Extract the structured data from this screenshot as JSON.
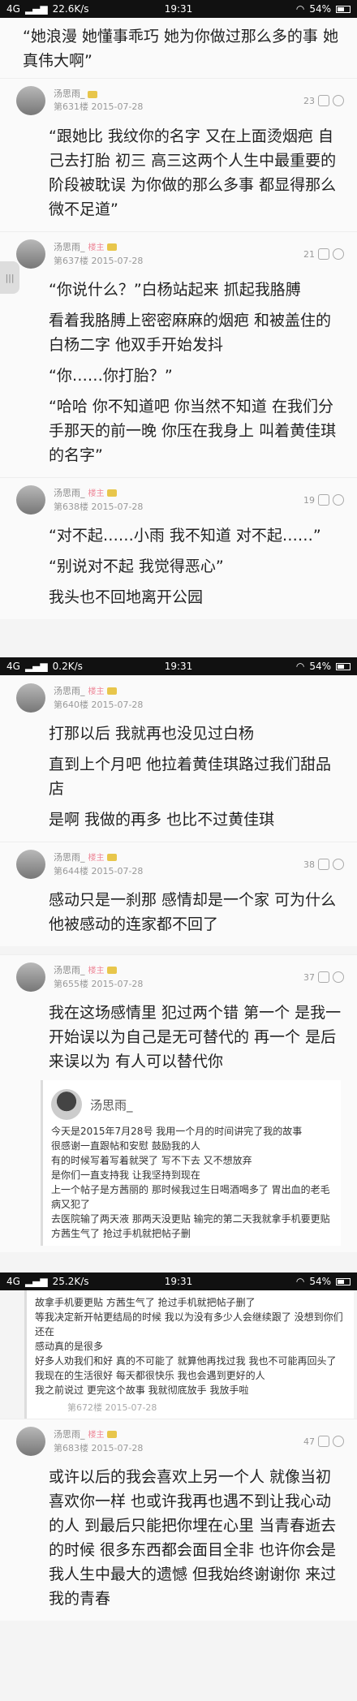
{
  "status_bars": [
    {
      "net": "4G",
      "speed": "22.6K/s",
      "time": "19:31",
      "battery": "54%"
    },
    {
      "net": "4G",
      "speed": "0.2K/s",
      "time": "19:31",
      "battery": "54%"
    },
    {
      "net": "4G",
      "speed": "25.2K/s",
      "time": "19:31",
      "battery": "54%"
    }
  ],
  "screen1": {
    "quote": "“她浪漫 她懂事乖巧 她为你做过那么多的事 她真伟大啊”",
    "posts": [
      {
        "name": "汤思雨_",
        "floor": "第631楼",
        "date": "2015-07-28",
        "likes": "23",
        "paragraphs": [
          "“跟她比 我纹你的名字 又在上面烫烟疤 自己去打胎 初三 高三这两个人生中最重要的阶段被耽误 为你做的那么多事 都显得那么微不足道”"
        ]
      },
      {
        "name": "汤思雨_",
        "badge": "楼主",
        "floor": "第637楼",
        "date": "2015-07-28",
        "likes": "21",
        "paragraphs": [
          "“你说什么？”白杨站起来 抓起我胳膊",
          "看着我胳膊上密密麻麻的烟疤 和被盖住的白杨二字 他双手开始发抖",
          "“你……你打胎？”",
          "“哈哈 你不知道吧 你当然不知道 在我们分手那天的前一晚 你压在我身上 叫着黄佳琪的名字”"
        ]
      },
      {
        "name": "汤思雨_",
        "badge": "楼主",
        "floor": "第638楼",
        "date": "2015-07-28",
        "likes": "19",
        "paragraphs": [
          "“对不起……小雨 我不知道 对不起……”",
          "“别说对不起 我觉得恶心”",
          "我头也不回地离开公园"
        ]
      }
    ],
    "side_handle": "|||"
  },
  "screen2": {
    "posts": [
      {
        "name": "汤思雨_",
        "badge": "楼主",
        "floor": "第640楼",
        "date": "2015-07-28",
        "likes": "",
        "paragraphs": [
          "打那以后 我就再也没见过白杨",
          "直到上个月吧 他拉着黄佳琪路过我们甜品店",
          "是啊 我做的再多 也比不过黄佳琪"
        ]
      },
      {
        "name": "汤思雨_",
        "badge": "楼主",
        "floor": "第644楼",
        "date": "2015-07-28",
        "likes": "38",
        "paragraphs": [
          "感动只是一刹那 感情却是一个家 可为什么 他被感动的连家都不回了"
        ]
      },
      {
        "name": "汤思雨_",
        "badge": "楼主",
        "floor": "第655楼",
        "date": "2015-07-28",
        "likes": "37",
        "paragraphs": [
          "我在这场感情里 犯过两个错 第一个 是我一开始误以为自己是无可替代的 再一个 是后来误以为 有人可以替代你"
        ]
      }
    ],
    "reply": {
      "name": "汤思雨_",
      "lines": [
        "今天是2015年7月28号 我用一个月的时间讲完了我的故事",
        "很感谢一直跟帖和安慰 鼓励我的人",
        "有的时候写着写着就哭了 写不下去 又不想放弃",
        "是你们一直支持我 让我坚持到现在",
        "上一个帖子是方茜丽的 那时候我过生日喝酒喝多了 胃出血的老毛病又犯了",
        "去医院输了两天液 那两天没更贴 输完的第二天我就拿手机要更贴 方茜生气了 抢过手机就把帖子删"
      ]
    }
  },
  "screen3": {
    "reply_lines": [
      "故拿手机要更贴 方茜生气了 抢过手机就把帖子删了",
      "等我决定新开帖更结局的时候 我以为没有多少人会继续跟了 没想到你们还在",
      "感动真的是很多",
      "好多人劝我们和好 真的不可能了 就算他再找过我 我也不可能再回头了",
      "我现在的生活很好 每天都很快乐 我也会遇到更好的人",
      "我之前说过 更完这个故事 我就彻底放手 我放手啦"
    ],
    "reply_floor": "第672楼",
    "reply_date": "2015-07-28",
    "post": {
      "name": "汤思雨_",
      "badge": "楼主",
      "floor": "第683楼",
      "date": "2015-07-28",
      "likes": "47",
      "paragraphs": [
        "或许以后的我会喜欢上另一个人 就像当初喜欢你一样 也或许我再也遇不到让我心动的人 到最后只能把你埋在心里 当青春逝去的时候 很多东西都会面目全非 也许你会是我人生中最大的遗憾 但我始终谢谢你 来过我的青春"
      ]
    }
  }
}
